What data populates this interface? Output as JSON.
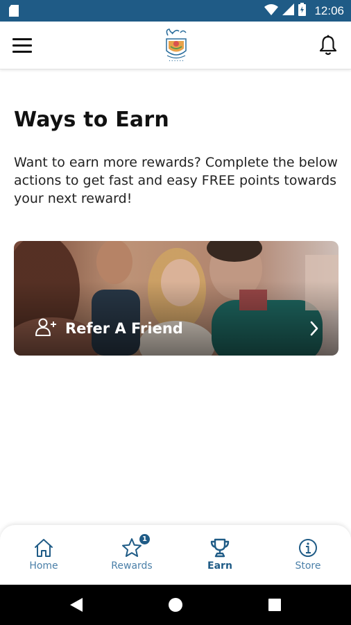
{
  "status_bar": {
    "time": "12:06",
    "icons": [
      "sd-card-icon",
      "wifi-icon",
      "cell-signal-icon",
      "battery-icon"
    ]
  },
  "header": {
    "menu_icon": "hamburger-menu-icon",
    "logo_icon": "brand-logo-icon",
    "notification_icon": "bell-icon"
  },
  "main": {
    "title": "Ways to Earn",
    "intro": "Want to earn more rewards? Complete the below actions to get fast and easy FREE points towards your next reward!",
    "cards": [
      {
        "label": "Refer A Friend",
        "icon": "add-user-icon",
        "chevron": "chevron-right-icon"
      }
    ]
  },
  "bottom_nav": {
    "items": [
      {
        "label": "Home",
        "icon": "home-icon",
        "active": false
      },
      {
        "label": "Rewards",
        "icon": "star-icon",
        "active": false,
        "badge": "1"
      },
      {
        "label": "Earn",
        "icon": "trophy-icon",
        "active": true
      },
      {
        "label": "Store",
        "icon": "info-icon",
        "active": false
      }
    ]
  },
  "android_nav": {
    "icons": [
      "back-triangle-icon",
      "home-circle-icon",
      "recents-square-icon"
    ]
  },
  "colors": {
    "brand_blue": "#1f5b86",
    "nav_inactive": "#4a7fa8",
    "text_dark": "#111111"
  }
}
